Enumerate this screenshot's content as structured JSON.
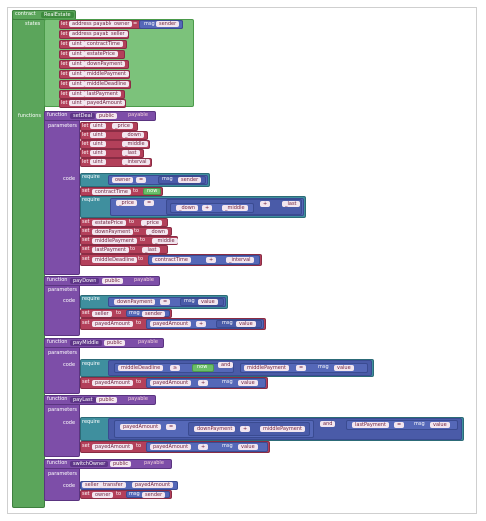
{
  "contract": {
    "keyword": "contract",
    "name": "RealEstate"
  },
  "state_label": "states",
  "states": [
    {
      "let": "let",
      "type": "address payable",
      "name": "owner",
      "eq": "=",
      "value": "msg",
      "value2": "sender"
    },
    {
      "let": "let",
      "type": "address payable",
      "name": "seller"
    },
    {
      "let": "let",
      "type": "uint",
      "name": "contractTime"
    },
    {
      "let": "let",
      "type": "uint",
      "name": "estatePrice"
    },
    {
      "let": "let",
      "type": "uint",
      "name": "downPayment"
    },
    {
      "let": "let",
      "type": "uint",
      "name": "middlePayment"
    },
    {
      "let": "let",
      "type": "uint",
      "name": "middleDeadline"
    },
    {
      "let": "let",
      "type": "uint",
      "name": "lastPayment"
    },
    {
      "let": "let",
      "type": "uint",
      "name": "payedAmount"
    }
  ],
  "functions_label": "functions",
  "f1": {
    "keyword": "function",
    "name": "setDeal",
    "vis": "public",
    "mod": "payable",
    "params_label": "parameters",
    "params": [
      [
        "let",
        "uint",
        "_price"
      ],
      [
        "let",
        "uint",
        "_down"
      ],
      [
        "let",
        "uint",
        "_middle"
      ],
      [
        "let",
        "uint",
        "_last"
      ],
      [
        "let",
        "uint",
        "_interval"
      ]
    ],
    "code_label": "code",
    "require": "require",
    "owner": "owner",
    "eq": "=",
    "msg": "msg",
    "sender": "sender",
    "price": "_price",
    "down": "_down",
    "plus": "+",
    "middle": "_middle",
    "last": "_last",
    "set": "set",
    "to": "to",
    "contractTime": "contractTime",
    "now": "now",
    "estatePrice": "estatePrice",
    "downPayment": "downPayment",
    "middlePayment": "middlePayment",
    "lastPayment": "lastPayment",
    "middleDeadline": "middleDeadline",
    "interval": "_interval"
  },
  "f2": {
    "keyword": "function",
    "name": "payDown",
    "vis": "public",
    "mod": "payable",
    "params_label": "parameters",
    "code_label": "code",
    "require": "require",
    "downPayment": "downPayment",
    "eq": "=",
    "msg": "msg",
    "value": "value",
    "set": "set",
    "seller": "seller",
    "to": "to",
    "sender": "sender",
    "payedAmount": "payedAmount",
    "plus": "+"
  },
  "f3": {
    "keyword": "function",
    "name": "payMiddle",
    "vis": "public",
    "mod": "payable",
    "params_label": "parameters",
    "code_label": "code",
    "require": "require",
    "middleDeadline": "middleDeadline",
    "gte": "≥",
    "now": "now",
    "and": "and",
    "middlePayment": "middlePayment",
    "eq": "=",
    "msg": "msg",
    "value": "value",
    "set": "set",
    "to": "to",
    "payedAmount": "payedAmount",
    "plus": "+"
  },
  "f4": {
    "keyword": "function",
    "name": "payLast",
    "vis": "public",
    "mod": "payable",
    "params_label": "parameters",
    "code_label": "code",
    "require": "require",
    "payedAmount": "payedAmount",
    "eq": "=",
    "downPayment": "downPayment",
    "plus": "+",
    "middlePayment": "middlePayment",
    "and": "and",
    "lastPayment": "lastPayment",
    "msg": "msg",
    "value": "value",
    "set": "set",
    "to": "to"
  },
  "f5": {
    "keyword": "function",
    "name": "switchOwner",
    "vis": "public",
    "mod": "payable",
    "params_label": "parameters",
    "code_label": "code",
    "seller": "seller",
    "transfer": "transfer",
    "payedAmount": "payedAmount",
    "set": "set",
    "owner": "owner",
    "to": "to",
    "msg": "msg",
    "sender": "sender"
  }
}
